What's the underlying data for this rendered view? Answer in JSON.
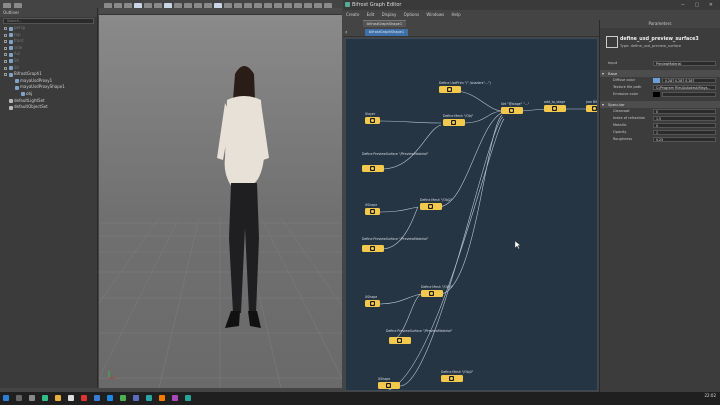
{
  "outliner": {
    "title": "Outliner",
    "search_placeholder": "Search...",
    "items": [
      {
        "label": "persp"
      },
      {
        "label": "top"
      },
      {
        "label": "front"
      },
      {
        "label": "side"
      },
      {
        "label": "Ani"
      },
      {
        "label": "Sh"
      },
      {
        "label": "Sh"
      },
      {
        "label": "BifrostGraph1"
      },
      {
        "label": "mayaUsdProxy1"
      },
      {
        "label": "mayaUsdProxyShape1"
      },
      {
        "label": "obj"
      },
      {
        "label": "defaultLightSet"
      },
      {
        "label": "defaultObjectSet"
      }
    ]
  },
  "graph_editor": {
    "title": "Bifrost Graph Editor",
    "menu": [
      "Create",
      "Edit",
      "Display",
      "Options",
      "Windows",
      "Help"
    ],
    "tab": "bifrostGraphShape1",
    "breadcrumb": "bifrostGraphShape1",
    "nodes": [
      {
        "label": "Define UsdPrim \"/\" (shaders\"...\")"
      },
      {
        "label": "Define Mesh \"/Obj\""
      },
      {
        "label": "Xlayer"
      },
      {
        "label": "Set \"@stage\" \"...\""
      },
      {
        "label": "add_to_stage"
      },
      {
        "label": "Jom Bit"
      },
      {
        "label": "XShape"
      },
      {
        "label": "Define PreviewSurface \"/PreviewMaterial\""
      },
      {
        "label": "XShape"
      },
      {
        "label": "Define Mesh \"/Obj2\""
      },
      {
        "label": "Define PreviewSurface \"/PreviewMaterial\""
      },
      {
        "label": "XShape"
      },
      {
        "label": "Define Mesh \"/Obj3\""
      },
      {
        "label": "Define PreviewSurface \"/PreviewMaterial\""
      },
      {
        "label": "XShape"
      },
      {
        "label": "Define Mesh \"/Obj4\""
      }
    ]
  },
  "attribute_editor": {
    "title": "Parameters",
    "node_name": "define_usd_preview_surface3",
    "node_type": "Type: define_usd_preview_surface",
    "input_label": "Input",
    "input_value": "PreviewMaterial",
    "sections": [
      {
        "label": "Base",
        "rows": [
          {
            "label": "Diffuse color",
            "value": "0.287  0.287  0.287"
          },
          {
            "label": "Texture file path",
            "value": "C:/Program Files/Autodesk/Maya..."
          },
          {
            "label": "Emissive color",
            "value": ""
          }
        ]
      },
      {
        "label": "Specular",
        "rows": [
          {
            "label": "Clearcoat",
            "value": "0"
          },
          {
            "label": "Index of refraction",
            "value": "1.5"
          },
          {
            "label": "Metallic",
            "value": "0"
          },
          {
            "label": "Opacity",
            "value": "1"
          },
          {
            "label": "Roughness",
            "value": "0.25"
          }
        ]
      }
    ]
  },
  "taskbar": {
    "time": "22:02",
    "date": "..."
  },
  "colors": {
    "graph_bg": "#263544",
    "node": "#f2c94c",
    "accent": "#3d6fa8"
  }
}
